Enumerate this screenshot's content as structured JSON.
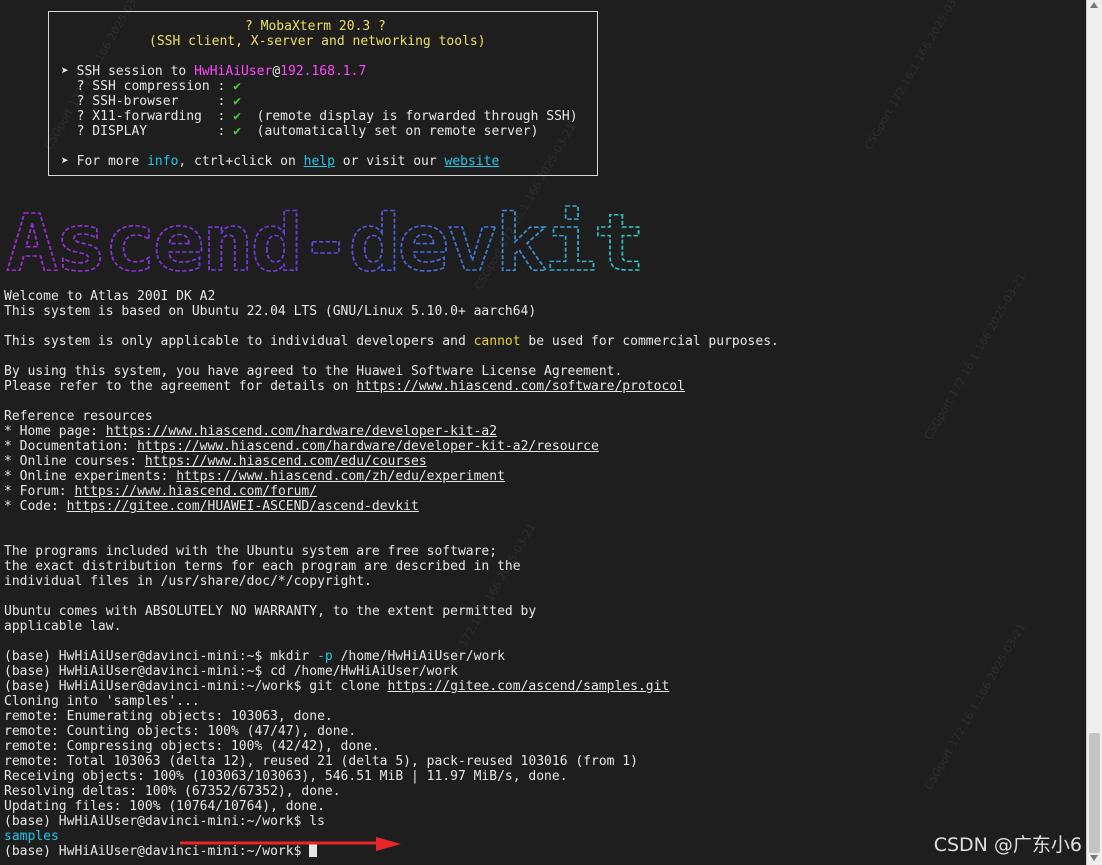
{
  "banner": {
    "title": "? MobaXterm 20.3 ?",
    "subtitle": "(SSH client, X-server and networking tools)",
    "session_prefix": "➤ SSH session to ",
    "session_user": "HwHiAiUser",
    "session_at": "@",
    "session_host": "192.168.1.7",
    "checks": [
      {
        "label": "  ? SSH compression : ",
        "mark": "✔",
        "note": ""
      },
      {
        "label": "  ? SSH-browser     : ",
        "mark": "✔",
        "note": ""
      },
      {
        "label": "  ? X11-forwarding  : ",
        "mark": "✔",
        "note": "  (remote display is forwarded through SSH)"
      },
      {
        "label": "  ? DISPLAY         : ",
        "mark": "✔",
        "note": "  (automatically set on remote server)"
      }
    ],
    "more_prefix": "➤ For more ",
    "more_info": "info",
    "more_mid": ", ctrl+click on ",
    "more_help": "help",
    "more_mid2": " or visit our ",
    "more_website": "website"
  },
  "ascii_logo": "Ascend-devkit",
  "motd": {
    "welcome": "Welcome to Atlas 200I DK A2",
    "system": "This system is based on Ubuntu 22.04 LTS (GNU/Linux 5.10.0+ aarch64)",
    "only_pre": "This system is only applicable to individual developers and ",
    "only_hl": "cannot",
    "only_post": " be used for commercial purposes.",
    "agree1": "By using this system, you have agreed to the Huawei Software License Agreement.",
    "agree2_pre": "Please refer to the agreement for details on ",
    "agree2_link": "https://www.hiascend.com/software/protocol",
    "ref_title": "Reference resources",
    "refs": [
      {
        "label": "* Home page: ",
        "url": "https://www.hiascend.com/hardware/developer-kit-a2"
      },
      {
        "label": "* Documentation: ",
        "url": "https://www.hiascend.com/hardware/developer-kit-a2/resource"
      },
      {
        "label": "* Online courses: ",
        "url": "https://www.hiascend.com/edu/courses"
      },
      {
        "label": "* Online experiments: ",
        "url": "https://www.hiascend.com/zh/edu/experiment"
      },
      {
        "label": "* Forum: ",
        "url": "https://www.hiascend.com/forum/"
      },
      {
        "label": "* Code: ",
        "url": "https://gitee.com/HUAWEI-ASCEND/ascend-devkit"
      }
    ],
    "free1": "The programs included with the Ubuntu system are free software;",
    "free2": "the exact distribution terms for each program are described in the",
    "free3": "individual files in /usr/share/doc/*/copyright.",
    "warr1": "Ubuntu comes with ABSOLUTELY NO WARRANTY, to the extent permitted by",
    "warr2": "applicable law."
  },
  "session": {
    "cmd1_prompt": "(base) HwHiAiUser@davinci-mini:~$ ",
    "cmd1_a": "mkdir ",
    "cmd1_flag": "-p",
    "cmd1_b": " /home/HwHiAiUser/work",
    "cmd2": "(base) HwHiAiUser@davinci-mini:~$ cd /home/HwHiAiUser/work",
    "cmd3_prompt": "(base) HwHiAiUser@davinci-mini:~/work$ git clone ",
    "cmd3_url": "https://gitee.com/ascend/samples.git",
    "out": [
      "Cloning into 'samples'...",
      "remote: Enumerating objects: 103063, done.",
      "remote: Counting objects: 100% (47/47), done.",
      "remote: Compressing objects: 100% (42/42), done.",
      "remote: Total 103063 (delta 12), reused 21 (delta 5), pack-reused 103016 (from 1)",
      "Receiving objects: 100% (103063/103063), 546.51 MiB | 11.97 MiB/s, done.",
      "Resolving deltas: 100% (67352/67352), done.",
      "Updating files: 100% (10764/10764), done."
    ],
    "cmd4": "(base) HwHiAiUser@davinci-mini:~/work$ ls",
    "ls_result": "samples",
    "cmd5": "(base) HwHiAiUser@davinci-mini:~/work$ "
  },
  "watermark_text": "CSGport 172.16.1.166 2025-03-21",
  "csdn_mark": "CSDN @广东小6",
  "colors": {
    "background": "#1e1e1e",
    "text": "#e6e6e6",
    "magenta": "#ff44ff",
    "cyan": "#22c7e8",
    "yellow": "#e8d13a",
    "green": "#3ecf3e",
    "arrow": "#e8262a"
  }
}
